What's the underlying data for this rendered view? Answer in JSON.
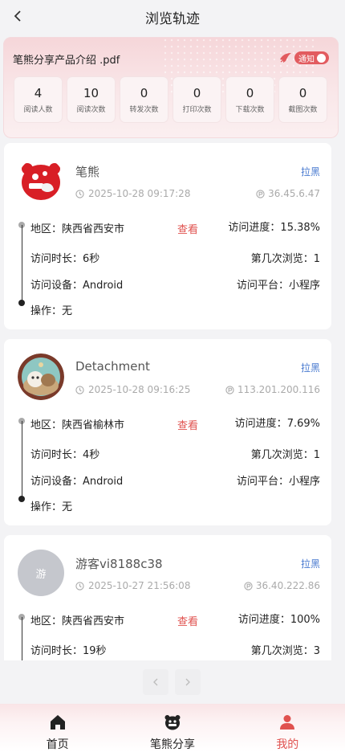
{
  "header": {
    "title": "浏览轨迹"
  },
  "summary": {
    "file_name": "笔熊分享产品介绍 .pdf",
    "notify_label": "通知",
    "stats": [
      {
        "value": "4",
        "label": "阅读人数"
      },
      {
        "value": "10",
        "label": "阅读次数"
      },
      {
        "value": "0",
        "label": "转发次数"
      },
      {
        "value": "0",
        "label": "打印次数"
      },
      {
        "value": "0",
        "label": "下载次数"
      },
      {
        "value": "0",
        "label": "截图次数"
      }
    ]
  },
  "labels": {
    "block": "拉黑",
    "region": "地区：",
    "view": "查看",
    "progress": "访问进度：",
    "duration": "访问时长：",
    "visit_no": "第几次浏览：",
    "device": "访问设备：",
    "platform": "访问平台：",
    "action": "操作："
  },
  "visits": [
    {
      "name": "笔熊",
      "time": "2025-10-28 09:17:28",
      "ip": "36.45.6.47",
      "region": "陕西省西安市",
      "progress": "15.38%",
      "duration": "6秒",
      "visit_no": "1",
      "device": "Android",
      "platform": "小程序",
      "action": "无"
    },
    {
      "name": "Detachment",
      "time": "2025-10-28 09:16:25",
      "ip": "113.201.200.116",
      "region": "陕西省榆林市",
      "progress": "7.69%",
      "duration": "4秒",
      "visit_no": "1",
      "device": "Android",
      "platform": "小程序",
      "action": "无"
    },
    {
      "name": "游客vi8188c38",
      "avatar_text": "游",
      "time": "2025-10-27 21:56:08",
      "ip": "36.40.222.86",
      "region": "陕西省西安市",
      "progress": "100%",
      "duration": "19秒",
      "visit_no": "3"
    }
  ],
  "tabbar": [
    {
      "label": "首页",
      "icon": "home-icon"
    },
    {
      "label": "笔熊分享",
      "icon": "bear-icon"
    },
    {
      "label": "我的",
      "icon": "user-icon",
      "active": true
    }
  ],
  "colors": {
    "accent": "#e0524f",
    "link": "#4a7bd0",
    "bg": "#f3f3f5"
  }
}
